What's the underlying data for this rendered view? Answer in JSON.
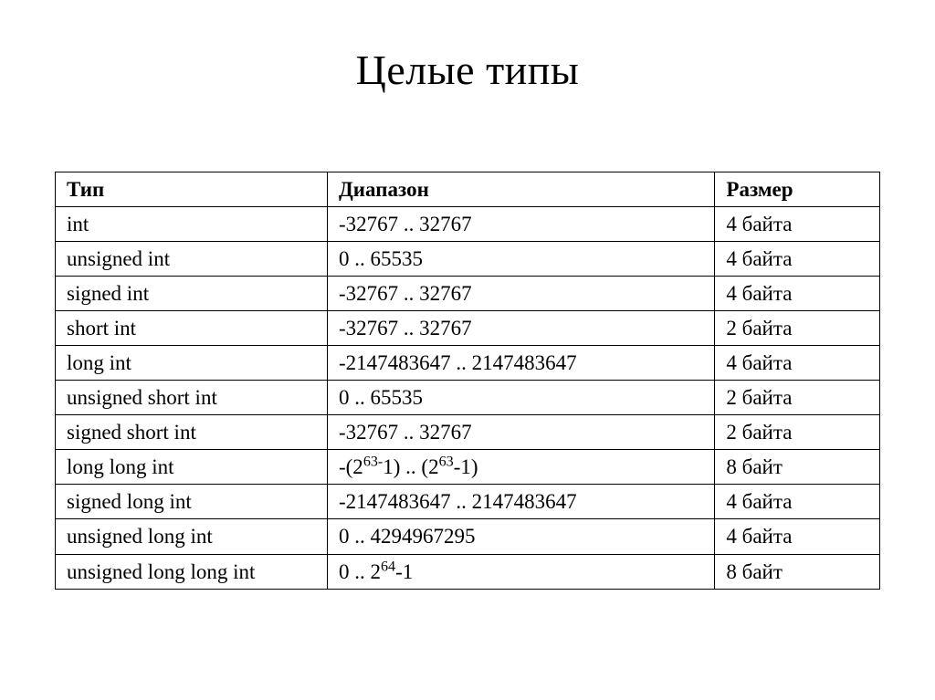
{
  "title": "Целые типы",
  "headers": {
    "type": "Тип",
    "range": "Диапазон",
    "size": "Размер"
  },
  "rows": [
    {
      "type": "int",
      "range": "-32767 .. 32767",
      "size": "4 байта"
    },
    {
      "type": "unsigned int",
      "range": "0 .. 65535",
      "size": "4 байта"
    },
    {
      "type": "signed int",
      "range": "-32767 .. 32767",
      "size": "4 байта"
    },
    {
      "type": "short int",
      "range": "-32767 .. 32767",
      "size": "2 байта"
    },
    {
      "type": "long int",
      "range": "-2147483647 .. 2147483647",
      "size": "4 байта"
    },
    {
      "type": "unsigned short int",
      "range": "0 .. 65535",
      "size": "2 байта"
    },
    {
      "type": "signed short int",
      "range": "-32767 .. 32767",
      "size": "2 байта"
    },
    {
      "type": "long long int",
      "range_html": "-(2<sup>63-</sup>1) .. (2<sup>63</sup>-1)",
      "size": "8 байт"
    },
    {
      "type": "signed long int",
      "range": "-2147483647 .. 2147483647",
      "size": "4 байта"
    },
    {
      "type": "unsigned long int",
      "range": "0 .. 4294967295",
      "size": "4 байта"
    },
    {
      "type": "unsigned long long int",
      "range_html": "0 .. 2<sup>64</sup>-1",
      "size": "8 байт"
    }
  ]
}
